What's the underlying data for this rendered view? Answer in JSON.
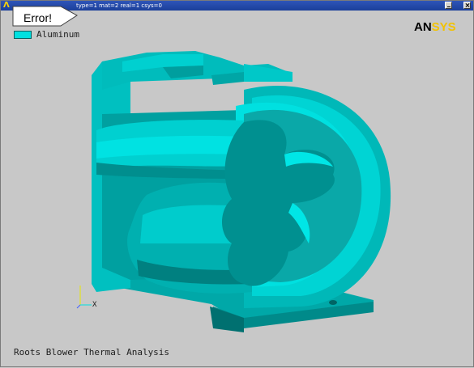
{
  "window": {
    "title": "type=1 mat=2 real=1 csys=0",
    "app_glyph": "Λ"
  },
  "error_callout": {
    "label": "Error!"
  },
  "legend": {
    "items": [
      {
        "label": "Aluminum",
        "color": "#00e0e0"
      }
    ]
  },
  "logo": {
    "part1": "AN",
    "part2": "SYS",
    "colors": {
      "part1": "#000000",
      "part2": "#f2c200"
    }
  },
  "triad": {
    "axis_label": "X"
  },
  "footer": {
    "title": "Roots Blower Thermal Analysis"
  },
  "colors": {
    "background": "#c8c8c8",
    "model_light": "#00d8d8",
    "model_mid": "#00b4b4",
    "model_dark": "#008c8c",
    "model_shadow": "#006a6a",
    "titlebar": "#1b3f9a"
  },
  "icons": {
    "minimize": "minimize-icon",
    "close": "close-icon"
  }
}
